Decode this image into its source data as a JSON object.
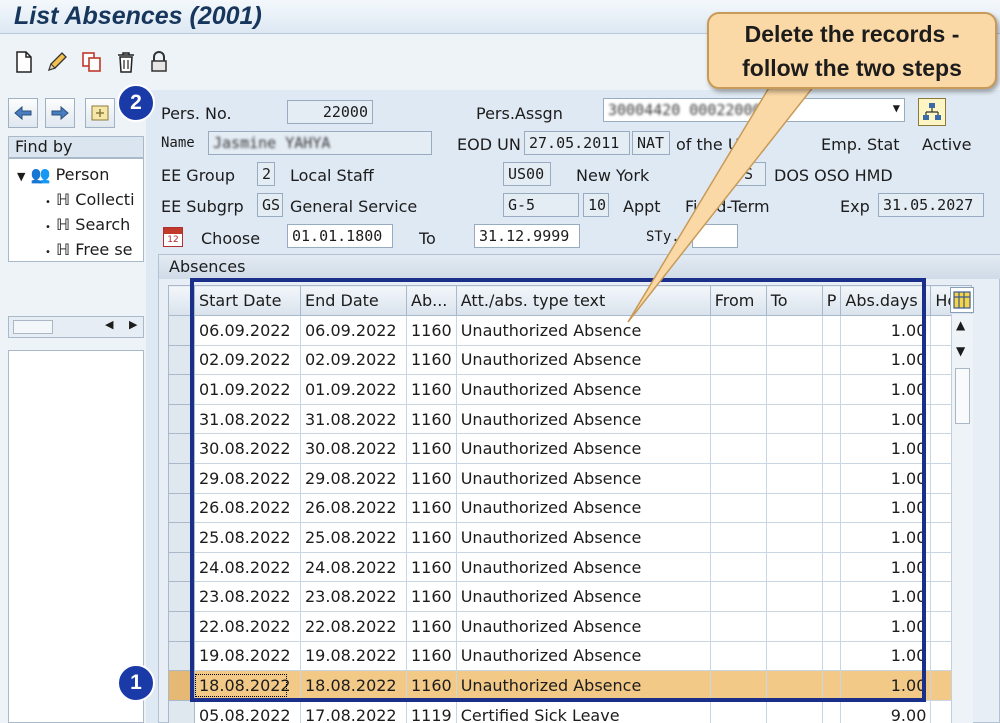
{
  "window": {
    "title": "List Absences (2001)"
  },
  "toolbar": {
    "icons": [
      "new-document-icon",
      "edit-pencil-icon",
      "copy-icon",
      "delete-trash-icon",
      "lock-icon"
    ]
  },
  "callout": {
    "line1": "Delete the records -",
    "line2": "follow the two steps"
  },
  "steps": {
    "one": "1",
    "two": "2"
  },
  "nav": {
    "find_by": "Find by",
    "tree": [
      {
        "label": "Person"
      },
      {
        "label": "Collecti"
      },
      {
        "label": "Search"
      },
      {
        "label": "Free se"
      }
    ]
  },
  "header": {
    "pers_no_label": "Pers. No.",
    "pers_no": "22000",
    "pers_assgn_label": "Pers.Assgn",
    "pers_assgn": "30004420 00022000",
    "name_label": "Name",
    "name": "Jasmine YAHYA",
    "eod_label": "EOD UN",
    "eod": "27.05.2011",
    "nat_label": "NAT",
    "nat_value": "of the USA",
    "emp_stat_label": "Emp. Stat",
    "emp_stat": "Active",
    "ee_group_label": "EE Group",
    "ee_group_code": "2",
    "ee_group_text": "Local Staff",
    "location_code": "US00",
    "location_text": "New York",
    "org_code": "OS",
    "org_text": "DOS OSO HMD",
    "ee_subgrp_label": "EE Subgrp",
    "ee_subgrp_code": "GS",
    "ee_subgrp_text": "General Service",
    "grade": "G-5",
    "step": "10",
    "appt_label": "Appt",
    "appt_text": "Fixed-Term",
    "exp_label": "Exp",
    "exp": "31.05.2027",
    "choose_label": "Choose",
    "from_date": "01.01.1800",
    "to_label": "To",
    "to_date": "31.12.9999",
    "sty_label": "STy.",
    "sty": ""
  },
  "absences": {
    "panel_title": "Absences",
    "columns": [
      "Start Date",
      "End Date",
      "Ab...",
      "Att./abs. type text",
      "From",
      "To",
      "P",
      "Abs.days",
      "Hou"
    ],
    "rows": [
      {
        "start": "06.09.2022",
        "end": "06.09.2022",
        "type": "1160",
        "text": "Unauthorized Absence",
        "from": "",
        "to": "",
        "p": "",
        "days": "1.00"
      },
      {
        "start": "02.09.2022",
        "end": "02.09.2022",
        "type": "1160",
        "text": "Unauthorized Absence",
        "from": "",
        "to": "",
        "p": "",
        "days": "1.00"
      },
      {
        "start": "01.09.2022",
        "end": "01.09.2022",
        "type": "1160",
        "text": "Unauthorized Absence",
        "from": "",
        "to": "",
        "p": "",
        "days": "1.00"
      },
      {
        "start": "31.08.2022",
        "end": "31.08.2022",
        "type": "1160",
        "text": "Unauthorized Absence",
        "from": "",
        "to": "",
        "p": "",
        "days": "1.00"
      },
      {
        "start": "30.08.2022",
        "end": "30.08.2022",
        "type": "1160",
        "text": "Unauthorized Absence",
        "from": "",
        "to": "",
        "p": "",
        "days": "1.00"
      },
      {
        "start": "29.08.2022",
        "end": "29.08.2022",
        "type": "1160",
        "text": "Unauthorized Absence",
        "from": "",
        "to": "",
        "p": "",
        "days": "1.00"
      },
      {
        "start": "26.08.2022",
        "end": "26.08.2022",
        "type": "1160",
        "text": "Unauthorized Absence",
        "from": "",
        "to": "",
        "p": "",
        "days": "1.00"
      },
      {
        "start": "25.08.2022",
        "end": "25.08.2022",
        "type": "1160",
        "text": "Unauthorized Absence",
        "from": "",
        "to": "",
        "p": "",
        "days": "1.00"
      },
      {
        "start": "24.08.2022",
        "end": "24.08.2022",
        "type": "1160",
        "text": "Unauthorized Absence",
        "from": "",
        "to": "",
        "p": "",
        "days": "1.00"
      },
      {
        "start": "23.08.2022",
        "end": "23.08.2022",
        "type": "1160",
        "text": "Unauthorized Absence",
        "from": "",
        "to": "",
        "p": "",
        "days": "1.00"
      },
      {
        "start": "22.08.2022",
        "end": "22.08.2022",
        "type": "1160",
        "text": "Unauthorized Absence",
        "from": "",
        "to": "",
        "p": "",
        "days": "1.00"
      },
      {
        "start": "19.08.2022",
        "end": "19.08.2022",
        "type": "1160",
        "text": "Unauthorized Absence",
        "from": "",
        "to": "",
        "p": "",
        "days": "1.00"
      },
      {
        "start": "18.08.2022",
        "end": "18.08.2022",
        "type": "1160",
        "text": "Unauthorized Absence",
        "from": "",
        "to": "",
        "p": "",
        "days": "1.00"
      },
      {
        "start": "05.08.2022",
        "end": "17.08.2022",
        "type": "1119",
        "text": "Certified Sick Leave",
        "from": "",
        "to": "",
        "p": "",
        "days": "9.00"
      }
    ]
  },
  "colors": {
    "highlight_row": "#f2c987",
    "frame_border": "#1a2f8a",
    "step_circle": "#1a3aa8",
    "callout_fill": "#fbd9a6"
  }
}
